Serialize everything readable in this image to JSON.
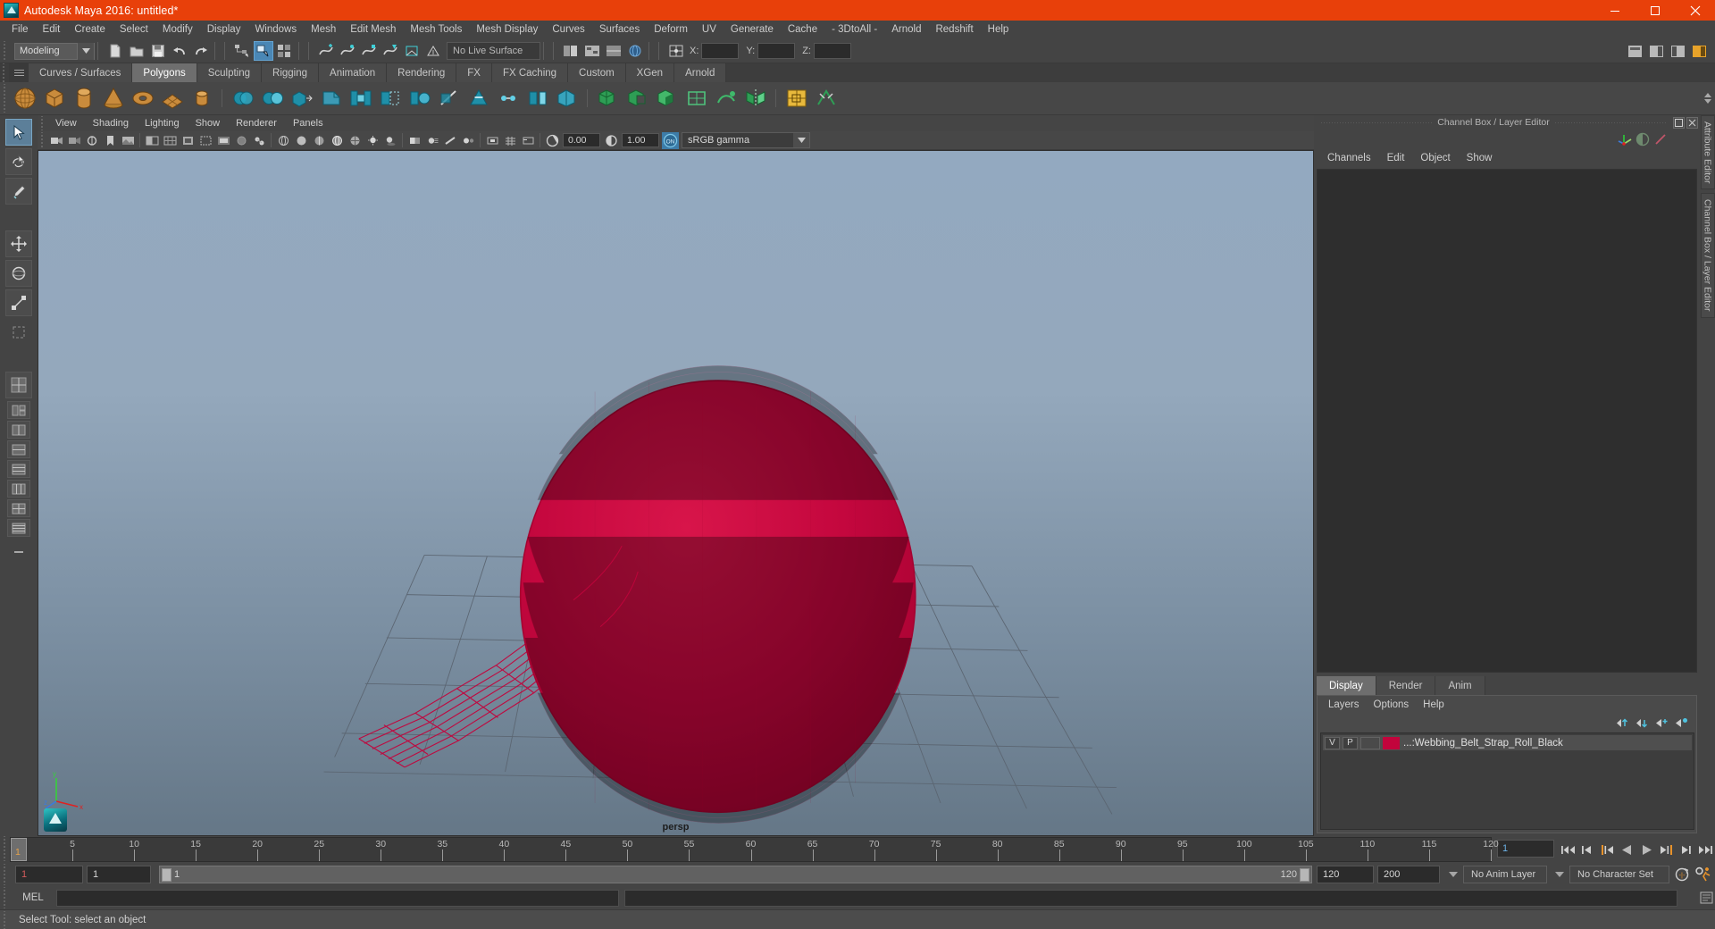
{
  "window": {
    "title": "Autodesk Maya 2016: untitled*",
    "accent": "#e8400a",
    "minimize_label": "–",
    "maximize_label": "❐",
    "close_label": "✕"
  },
  "menubar": {
    "items": [
      "File",
      "Edit",
      "Create",
      "Select",
      "Modify",
      "Display",
      "Windows",
      "Mesh",
      "Edit Mesh",
      "Mesh Tools",
      "Mesh Display",
      "Curves",
      "Surfaces",
      "Deform",
      "UV",
      "Generate",
      "Cache",
      "- 3DtoAll -",
      "Arnold",
      "Redshift",
      "Help"
    ]
  },
  "statusline": {
    "mode": "Modeling",
    "live_surface": "No Live Surface",
    "coord_labels": [
      "X:",
      "Y:",
      "Z:"
    ],
    "coord_values": [
      "",
      "",
      ""
    ],
    "icons": [
      "new-scene-icon",
      "open-scene-icon",
      "save-scene-icon",
      "undo-icon",
      "redo-icon",
      "select-by-hierarchy-icon",
      "select-by-object-icon",
      "select-by-component-icon",
      "snap-to-curve-icon",
      "snap-to-grid-icon",
      "snap-to-point-icon",
      "snap-to-projected-icon",
      "snap-to-view-plane-icon",
      "make-live-icon",
      "render-current-frame-icon",
      "ipr-render-icon",
      "render-settings-icon",
      "toggle-channel-box-icon",
      "toggle-layer-editor-icon",
      "toggle-attribute-editor-icon"
    ]
  },
  "shelf": {
    "tabs": [
      "Curves / Surfaces",
      "Polygons",
      "Sculpting",
      "Rigging",
      "Animation",
      "Rendering",
      "FX",
      "FX Caching",
      "Custom",
      "XGen",
      "Arnold"
    ],
    "active_tab": "Polygons",
    "buttons": [
      "polygon-sphere-icon",
      "polygon-cube-icon",
      "polygon-cylinder-icon",
      "polygon-cone-icon",
      "polygon-torus-icon",
      "polygon-plane-icon",
      "polygon-disc-icon",
      "combine-icon",
      "separate-icon",
      "extrude-icon",
      "bevel-icon",
      "bridge-icon",
      "append-polygon-icon",
      "smooth-icon",
      "multi-cut-icon",
      "target-weld-icon",
      "connect-icon",
      "detach-icon",
      "merge-icon",
      "mirror-icon",
      "booleans-union-icon",
      "booleans-difference-icon",
      "booleans-intersection-icon",
      "quad-draw-icon",
      "sculpt-icon",
      "uv-editor-icon",
      "crease-icon"
    ]
  },
  "toolbox": {
    "items": [
      "select-tool",
      "lasso-select-tool",
      "paint-select-tool",
      "move-tool",
      "rotate-tool",
      "scale-tool",
      "last-tool-used",
      "single-perspective-view-layout",
      "four-view-layout",
      "persp-outliner-layout",
      "persp-graph-editor-layout",
      "hypershade-persp-layout",
      "persp-two-pane-layout",
      "persp-three-pane-layout",
      "persp-four-pane-layout",
      "expand-layouts"
    ],
    "selected": "select-tool"
  },
  "viewport": {
    "menus": [
      "View",
      "Shading",
      "Lighting",
      "Show",
      "Renderer",
      "Panels"
    ],
    "camera_label": "persp",
    "exposure_value": "0.00",
    "gamma_value": "1.00",
    "color_management": "sRGB gamma",
    "color_management_enabled_label": "ON",
    "toolbar_icons": [
      "select-camera-icon",
      "lock-camera-icon",
      "camera-attributes-icon",
      "bookmark-icon",
      "image-plane-icon",
      "two-sided-lighting-icon",
      "grid-display-icon",
      "film-gate-icon",
      "resolution-gate-icon",
      "gate-mask-icon",
      "xray-icon",
      "xray-joints-icon",
      "wireframe-on-shaded-icon",
      "smooth-shade-all-icon",
      "flat-shade-icon",
      "wireframe-icon",
      "shaded-textured-icon",
      "use-all-lights-icon",
      "shadows-icon",
      "screen-space-ao-icon",
      "motion-blur-icon",
      "multisample-icon",
      "depth-of-field-icon",
      "isolate-select-icon",
      "grid-toggle-icon",
      "hud-toggle-icon",
      "exposure-icon",
      "gamma-icon"
    ]
  },
  "scene": {
    "object_color": "#c2043c",
    "ground_grid_color": "#5c6570"
  },
  "rightpanel": {
    "panel_title": "Channel Box / Layer Editor",
    "restore_label": "❐",
    "close_label": "✕",
    "menus": [
      "Channels",
      "Edit",
      "Object",
      "Show"
    ],
    "channel_box_empty": "",
    "vertical_tabs": [
      "Attribute Editor",
      "Channel Box / Layer Editor"
    ],
    "top_icons": [
      "move-axis-icon",
      "half-circle-icon",
      "slash-icon"
    ]
  },
  "layer_editor": {
    "tabs": [
      "Display",
      "Render",
      "Anim"
    ],
    "active_tab": "Display",
    "menus": [
      "Layers",
      "Options",
      "Help"
    ],
    "buttons": [
      "move-layer-up-icon",
      "move-layer-down-icon",
      "new-layer-icon",
      "new-layer-from-selected-icon"
    ],
    "layers": [
      {
        "visibility": "V",
        "playback": "P",
        "display_type": "",
        "color": "#c2043c",
        "name": "...:Webbing_Belt_Strap_Roll_Black"
      }
    ]
  },
  "timeslider": {
    "ticks": [
      5,
      10,
      15,
      20,
      25,
      30,
      35,
      40,
      45,
      50,
      55,
      60,
      65,
      70,
      75,
      80,
      85,
      90,
      95,
      100,
      105,
      110,
      115,
      120
    ],
    "current_frame": "1",
    "current_frame_field": "1",
    "playback_buttons": [
      "go-to-start-icon",
      "step-back-keyframe-icon",
      "step-back-frame-icon",
      "play-backwards-icon",
      "play-forwards-icon",
      "step-forward-frame-icon",
      "step-forward-keyframe-icon",
      "go-to-end-icon"
    ]
  },
  "rangeslider": {
    "anim_start": "1",
    "range_start": "1",
    "bar_min_label": "1",
    "bar_max_label": "120",
    "range_end": "120",
    "anim_end": "200",
    "anim_layer": "No Anim Layer",
    "character_set": "No Character Set",
    "auto_key_icon": "auto-keyframe-icon",
    "anim_prefs_icon": "animation-preferences-icon"
  },
  "commandline": {
    "language_label": "MEL",
    "input_value": "",
    "output_value": "",
    "script_editor_icon": "script-editor-icon"
  },
  "helpline": {
    "text": "Select Tool: select an object"
  }
}
